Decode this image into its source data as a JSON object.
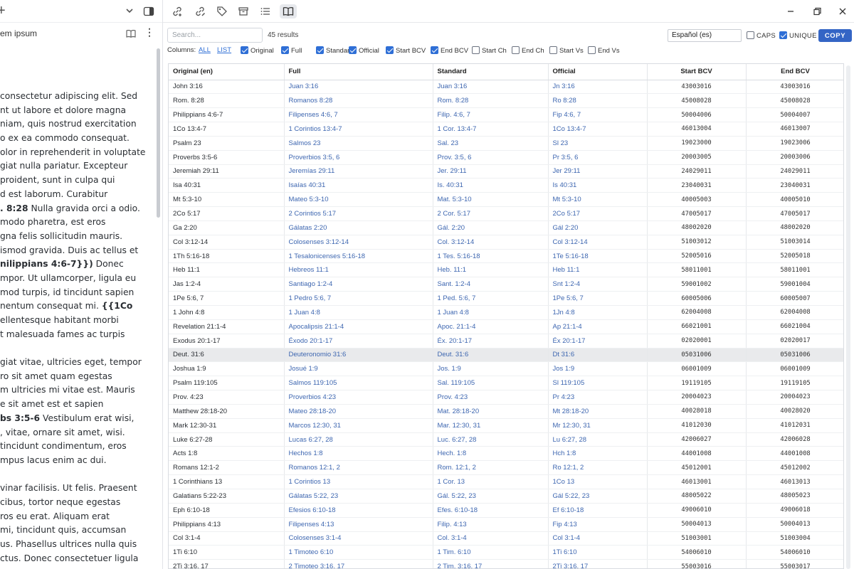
{
  "left_pane": {
    "new_label": "+",
    "doc_title": "em ipsum",
    "lines": [
      [
        {
          "t": "consectetur adipiscing elit. Sed",
          "b": false
        }
      ],
      [
        {
          "t": "nt ut labore et dolore magna",
          "b": false
        }
      ],
      [
        {
          "t": "niam, quis nostrud exercitation",
          "b": false
        }
      ],
      [
        {
          "t": "o ex ea commodo consequat.",
          "b": false
        }
      ],
      [
        {
          "t": "olor in reprehenderit in voluptate",
          "b": false
        }
      ],
      [
        {
          "t": "giat nulla pariatur. Excepteur",
          "b": false
        }
      ],
      [
        {
          "t": "proident, sunt in culpa qui",
          "b": false
        }
      ],
      [
        {
          "t": "d est laborum. Curabitur",
          "b": false
        }
      ],
      [
        {
          "t": ". 8:28",
          "b": true
        },
        {
          "t": " Nulla gravida orci a odio.",
          "b": false
        }
      ],
      [
        {
          "t": "modo pharetra, est eros",
          "b": false
        }
      ],
      [
        {
          "t": "gna felis sollicitudin mauris.",
          "b": false
        }
      ],
      [
        {
          "t": "ismod gravida. Duis ac tellus et",
          "b": false
        }
      ],
      [
        {
          "t": "nilippians 4:6-7}})",
          "b": true
        },
        {
          "t": " Donec",
          "b": false
        }
      ],
      [
        {
          "t": "mpor. Ut ullamcorper, ligula eu",
          "b": false
        }
      ],
      [
        {
          "t": "mod turpis, id tincidunt sapien",
          "b": false
        }
      ],
      [
        {
          "t": "nentum consequat mi. ",
          "b": false
        },
        {
          "t": "{{1Co",
          "b": true
        }
      ],
      [
        {
          "t": "ellentesque habitant morbi",
          "b": false
        }
      ],
      [
        {
          "t": "t malesuada fames ac turpis",
          "b": false
        }
      ],
      [
        {
          "t": "",
          "b": false
        }
      ],
      [
        {
          "t": "giat vitae, ultricies eget, tempor",
          "b": false
        }
      ],
      [
        {
          "t": "ro sit amet quam egestas",
          "b": false
        }
      ],
      [
        {
          "t": "m ultricies mi vitae est. Mauris",
          "b": false
        }
      ],
      [
        {
          "t": "e sit amet est et sapien",
          "b": false
        }
      ],
      [
        {
          "t": "bs 3:5-6",
          "b": true
        },
        {
          "t": " Vestibulum erat wisi,",
          "b": false
        }
      ],
      [
        {
          "t": ", vitae, ornare sit amet, wisi.",
          "b": false
        }
      ],
      [
        {
          "t": "tincidunt condimentum, eros",
          "b": false
        }
      ],
      [
        {
          "t": "mpus lacus enim ac dui.",
          "b": false
        }
      ],
      [
        {
          "t": "",
          "b": false
        }
      ],
      [
        {
          "t": "vinar facilisis. Ut felis. Praesent",
          "b": false
        }
      ],
      [
        {
          "t": "cibus, tortor neque egestas",
          "b": false
        }
      ],
      [
        {
          "t": "ros eu erat. Aliquam erat",
          "b": false
        }
      ],
      [
        {
          "t": "mi, tincidunt quis, accumsan",
          "b": false
        }
      ],
      [
        {
          "t": "us. Phasellus ultrices nulla quis",
          "b": false
        }
      ],
      [
        {
          "t": "ctus. Donec consectetuer ligula",
          "b": false
        }
      ]
    ]
  },
  "toolbar": {
    "icons": [
      "link-add-icon",
      "link-edit-icon",
      "tag-icon",
      "archive-icon",
      "list-icon",
      "book-open-icon"
    ]
  },
  "controls": {
    "search_placeholder": "Search...",
    "results": "45 results",
    "language": "Español (es)",
    "caps_label": "CAPS",
    "caps_checked": false,
    "unique_label": "UNIQUE",
    "unique_checked": true,
    "copy_label": "COPY"
  },
  "columns_row": {
    "label": "Columns:",
    "all": "ALL",
    "list": "LIST",
    "toggles": [
      {
        "label": "Original",
        "checked": true
      },
      {
        "label": "Full",
        "checked": true
      },
      {
        "label": "Standard",
        "checked": true
      },
      {
        "label": "Official",
        "checked": true
      },
      {
        "label": "Start BCV",
        "checked": true
      },
      {
        "label": "End BCV",
        "checked": true
      },
      {
        "label": "Start Ch",
        "checked": false
      },
      {
        "label": "End Ch",
        "checked": false
      },
      {
        "label": "Start Vs",
        "checked": false
      },
      {
        "label": "End Vs",
        "checked": false
      }
    ]
  },
  "table": {
    "headers": [
      "Original (en)",
      "Full",
      "Standard",
      "Official",
      "Start BCV",
      "End BCV"
    ],
    "selected_row": 19,
    "rows": [
      [
        "John 3:16",
        "Juan 3:16",
        "Juan 3:16",
        "Jn 3:16",
        "43003016",
        "43003016"
      ],
      [
        "Rom. 8:28",
        "Romanos 8:28",
        "Rom. 8:28",
        "Ro 8:28",
        "45008028",
        "45008028"
      ],
      [
        "Philippians 4:6-7",
        "Filipenses 4:6, 7",
        "Filip. 4:6, 7",
        "Fip 4:6, 7",
        "50004006",
        "50004007"
      ],
      [
        "1Co 13:4-7",
        "1 Corintios 13:4-7",
        "1 Cor. 13:4-7",
        "1Co 13:4-7",
        "46013004",
        "46013007"
      ],
      [
        "Psalm 23",
        "Salmos 23",
        "Sal. 23",
        "Sl 23",
        "19023000",
        "19023006"
      ],
      [
        "Proverbs 3:5-6",
        "Proverbios 3:5, 6",
        "Prov. 3:5, 6",
        "Pr 3:5, 6",
        "20003005",
        "20003006"
      ],
      [
        "Jeremiah 29:11",
        "Jeremías 29:11",
        "Jer. 29:11",
        "Jer 29:11",
        "24029011",
        "24029011"
      ],
      [
        "Isa 40:31",
        "Isaías 40:31",
        "Is. 40:31",
        "Is 40:31",
        "23040031",
        "23040031"
      ],
      [
        "Mt 5:3-10",
        "Mateo 5:3-10",
        "Mat. 5:3-10",
        "Mt 5:3-10",
        "40005003",
        "40005010"
      ],
      [
        "2Co 5:17",
        "2 Corintios 5:17",
        "2 Cor. 5:17",
        "2Co 5:17",
        "47005017",
        "47005017"
      ],
      [
        "Ga 2:20",
        "Gálatas 2:20",
        "Gál. 2:20",
        "Gál 2:20",
        "48002020",
        "48002020"
      ],
      [
        "Col 3:12-14",
        "Colosenses 3:12-14",
        "Col. 3:12-14",
        "Col 3:12-14",
        "51003012",
        "51003014"
      ],
      [
        "1Th 5:16-18",
        "1 Tesalonicenses 5:16-18",
        "1 Tes. 5:16-18",
        "1Te 5:16-18",
        "52005016",
        "52005018"
      ],
      [
        "Heb 11:1",
        "Hebreos 11:1",
        "Heb. 11:1",
        "Heb 11:1",
        "58011001",
        "58011001"
      ],
      [
        "Jas 1:2-4",
        "Santiago 1:2-4",
        "Sant. 1:2-4",
        "Snt 1:2-4",
        "59001002",
        "59001004"
      ],
      [
        "1Pe 5:6, 7",
        "1 Pedro 5:6, 7",
        "1 Ped. 5:6, 7",
        "1Pe 5:6, 7",
        "60005006",
        "60005007"
      ],
      [
        "1 John 4:8",
        "1 Juan 4:8",
        "1 Juan 4:8",
        "1Jn 4:8",
        "62004008",
        "62004008"
      ],
      [
        "Revelation 21:1-4",
        "Apocalipsis 21:1-4",
        "Apoc. 21:1-4",
        "Ap 21:1-4",
        "66021001",
        "66021004"
      ],
      [
        "Exodus 20:1-17",
        "Éxodo 20:1-17",
        "Éx. 20:1-17",
        "Éx 20:1-17",
        "02020001",
        "02020017"
      ],
      [
        "Deut. 31:6",
        "Deuteronomio 31:6",
        "Deut. 31:6",
        "Dt 31:6",
        "05031006",
        "05031006"
      ],
      [
        "Joshua 1:9",
        "Josué 1:9",
        "Jos. 1:9",
        "Jos 1:9",
        "06001009",
        "06001009"
      ],
      [
        "Psalm 119:105",
        "Salmos 119:105",
        "Sal. 119:105",
        "Sl 119:105",
        "19119105",
        "19119105"
      ],
      [
        "Prov. 4:23",
        "Proverbios 4:23",
        "Prov. 4:23",
        "Pr 4:23",
        "20004023",
        "20004023"
      ],
      [
        "Matthew 28:18-20",
        "Mateo 28:18-20",
        "Mat. 28:18-20",
        "Mt 28:18-20",
        "40028018",
        "40028020"
      ],
      [
        "Mark 12:30-31",
        "Marcos 12:30, 31",
        "Mar. 12:30, 31",
        "Mr 12:30, 31",
        "41012030",
        "41012031"
      ],
      [
        "Luke 6:27-28",
        "Lucas 6:27, 28",
        "Luc. 6:27, 28",
        "Lu 6:27, 28",
        "42006027",
        "42006028"
      ],
      [
        "Acts 1:8",
        "Hechos 1:8",
        "Hech. 1:8",
        "Hch 1:8",
        "44001008",
        "44001008"
      ],
      [
        "Romans 12:1-2",
        "Romanos 12:1, 2",
        "Rom. 12:1, 2",
        "Ro 12:1, 2",
        "45012001",
        "45012002"
      ],
      [
        "1 Corinthians 13",
        "1 Corintios 13",
        "1 Cor. 13",
        "1Co 13",
        "46013001",
        "46013013"
      ],
      [
        "Galatians 5:22-23",
        "Gálatas 5:22, 23",
        "Gál. 5:22, 23",
        "Gál 5:22, 23",
        "48005022",
        "48005023"
      ],
      [
        "Eph 6:10-18",
        "Efesios 6:10-18",
        "Efes. 6:10-18",
        "Ef 6:10-18",
        "49006010",
        "49006018"
      ],
      [
        "Philippians 4:13",
        "Filipenses 4:13",
        "Filip. 4:13",
        "Fip 4:13",
        "50004013",
        "50004013"
      ],
      [
        "Col 3:1-4",
        "Colosenses 3:1-4",
        "Col. 3:1-4",
        "Col 3:1-4",
        "51003001",
        "51003004"
      ],
      [
        "1Ti 6:10",
        "1 Timoteo 6:10",
        "1 Tim. 6:10",
        "1Ti 6:10",
        "54006010",
        "54006010"
      ],
      [
        "2Ti 3:16, 17",
        "2 Timoteo 3:16, 17",
        "2 Tim. 3:16, 17",
        "2Ti 3:16, 17",
        "55003016",
        "55003017"
      ]
    ]
  },
  "colors": {
    "accent": "#3465c5",
    "link_text": "#3d66b0",
    "selected_row": "#e9eaec"
  }
}
